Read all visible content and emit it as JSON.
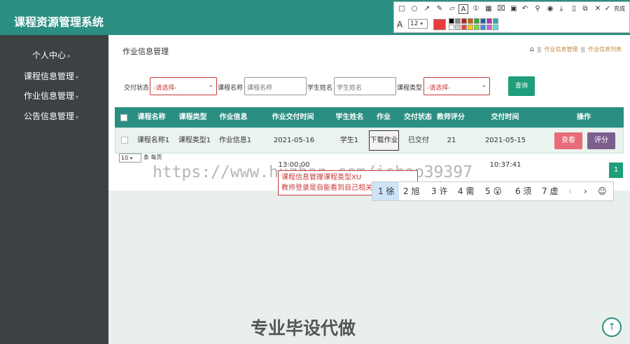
{
  "app_title": "课程资源管理系统",
  "sidebar": {
    "items": [
      {
        "label": "个人中心"
      },
      {
        "label": "课程信息管理"
      },
      {
        "label": "作业信息管理"
      },
      {
        "label": "公告信息管理"
      }
    ]
  },
  "page_title": "作业信息管理",
  "breadcrumb": {
    "sep": "||",
    "items": [
      "作业信息管理",
      "作业信息列表"
    ]
  },
  "filters": {
    "status_label": "交付状态",
    "status_value": "-请选择-",
    "course_label": "课程名称",
    "course_placeholder": "课程名称",
    "student_label": "学生姓名",
    "student_placeholder": "学生姓名",
    "type_label": "课程类型",
    "type_value": "-请选择-",
    "search_button": "查询"
  },
  "table": {
    "headers": [
      "课程名称",
      "课程类型",
      "作业信息",
      "作业交付时间",
      "学生姓名",
      "作业",
      "交付状态",
      "教师评分",
      "交付时间",
      "操作"
    ],
    "rows": [
      {
        "course": "课程名称1",
        "type": "课程类型1",
        "info": "作业信息1",
        "submit_time": "2021-05-16 13:00:00",
        "student": "学生1",
        "download": "下载作业",
        "status": "已交付",
        "score": "21",
        "deliver_time": "2021-05-15 10:37:41",
        "view": "查看",
        "rate": "评分"
      }
    ]
  },
  "pagination": {
    "page_size": "10",
    "page_size_label": "条 每页",
    "current_page": "1"
  },
  "toolbar": {
    "done_label": "完成",
    "font_size": "12"
  },
  "watermark": "https://www.huzhan.com/ishop39397",
  "tooltip": {
    "line1": "课程信息管理课程类型XU",
    "line2": "教师登录是自能看到自己相关"
  },
  "ime": {
    "candidates": [
      {
        "num": "1",
        "text": "徐"
      },
      {
        "num": "2",
        "text": "旭"
      },
      {
        "num": "3",
        "text": "许"
      },
      {
        "num": "4",
        "text": "需"
      },
      {
        "num": "5",
        "text": "😮"
      },
      {
        "num": "6",
        "text": "须"
      },
      {
        "num": "7",
        "text": "虚"
      }
    ]
  },
  "footer_text": "专业毕设代做",
  "colors": {
    "primary": "#2a8f82",
    "sidebar": "#3c4244",
    "view_button": "#e96a78",
    "rate_button": "#7c5f8f",
    "search_button": "#1e9e7a"
  }
}
